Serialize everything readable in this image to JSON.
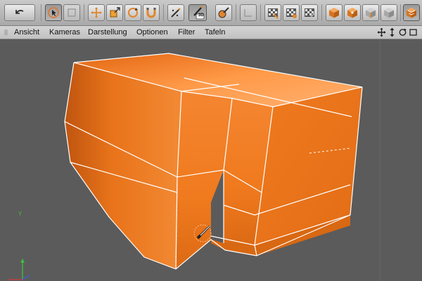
{
  "toolbar": {
    "buttons": [
      {
        "name": "undo",
        "icon": "undo-arrow-icon"
      },
      {
        "name": "select-live",
        "icon": "cursor-select-icon"
      },
      {
        "name": "select-disabled",
        "icon": "rect-select-icon"
      },
      {
        "name": "move",
        "icon": "move-cross-icon"
      },
      {
        "name": "scale",
        "icon": "scale-icon"
      },
      {
        "name": "rotate",
        "icon": "rotate-icon"
      },
      {
        "name": "magnet",
        "icon": "magnet-icon"
      },
      {
        "name": "knife",
        "icon": "knife-icon"
      },
      {
        "name": "brush-3d",
        "icon": "brush-3d-icon"
      },
      {
        "name": "paint",
        "icon": "paint-icon"
      },
      {
        "name": "workplane",
        "icon": "workplane-icon"
      },
      {
        "name": "render-view",
        "icon": "render-view-icon"
      },
      {
        "name": "render-picture",
        "icon": "render-picture-icon"
      },
      {
        "name": "render-settings",
        "icon": "render-settings-icon"
      },
      {
        "name": "model-mode",
        "icon": "cube-icon"
      },
      {
        "name": "points-mode",
        "icon": "points-cube-icon"
      },
      {
        "name": "edges-mode",
        "icon": "edges-cube-icon"
      },
      {
        "name": "polygons-mode",
        "icon": "polygons-cube-icon"
      },
      {
        "name": "camera-sculpt",
        "icon": "sculpt-cube-icon"
      }
    ],
    "brush_badge": "3D"
  },
  "menu": {
    "items": [
      "Ansicht",
      "Kameras",
      "Darstellung",
      "Optionen",
      "Filter",
      "Tafeln"
    ]
  },
  "viewport": {
    "axis_y_label": "Y",
    "object_color": "#f07a1e",
    "edge_color": "#ffffff"
  }
}
